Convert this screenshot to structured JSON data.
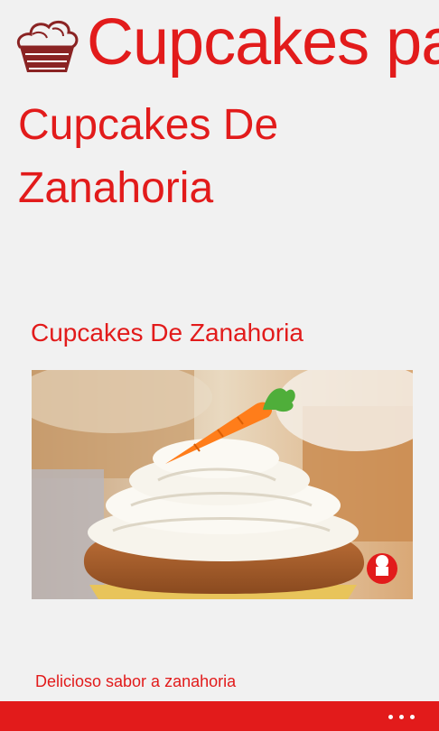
{
  "header": {
    "app_title": "Cupcakes para"
  },
  "page": {
    "title": "Cupcakes De Zanahoria"
  },
  "item": {
    "title": "Cupcakes De Zanahoria",
    "description": "Delicioso sabor a zanahoria"
  },
  "app_bar": {
    "more_icon": "ellipsis-icon"
  },
  "colors": {
    "accent": "#e21b1b",
    "background": "#f1f1f1",
    "frosting": "#f6f3ea",
    "cake": "#b5662f",
    "carrot": "#ff7d1a"
  }
}
